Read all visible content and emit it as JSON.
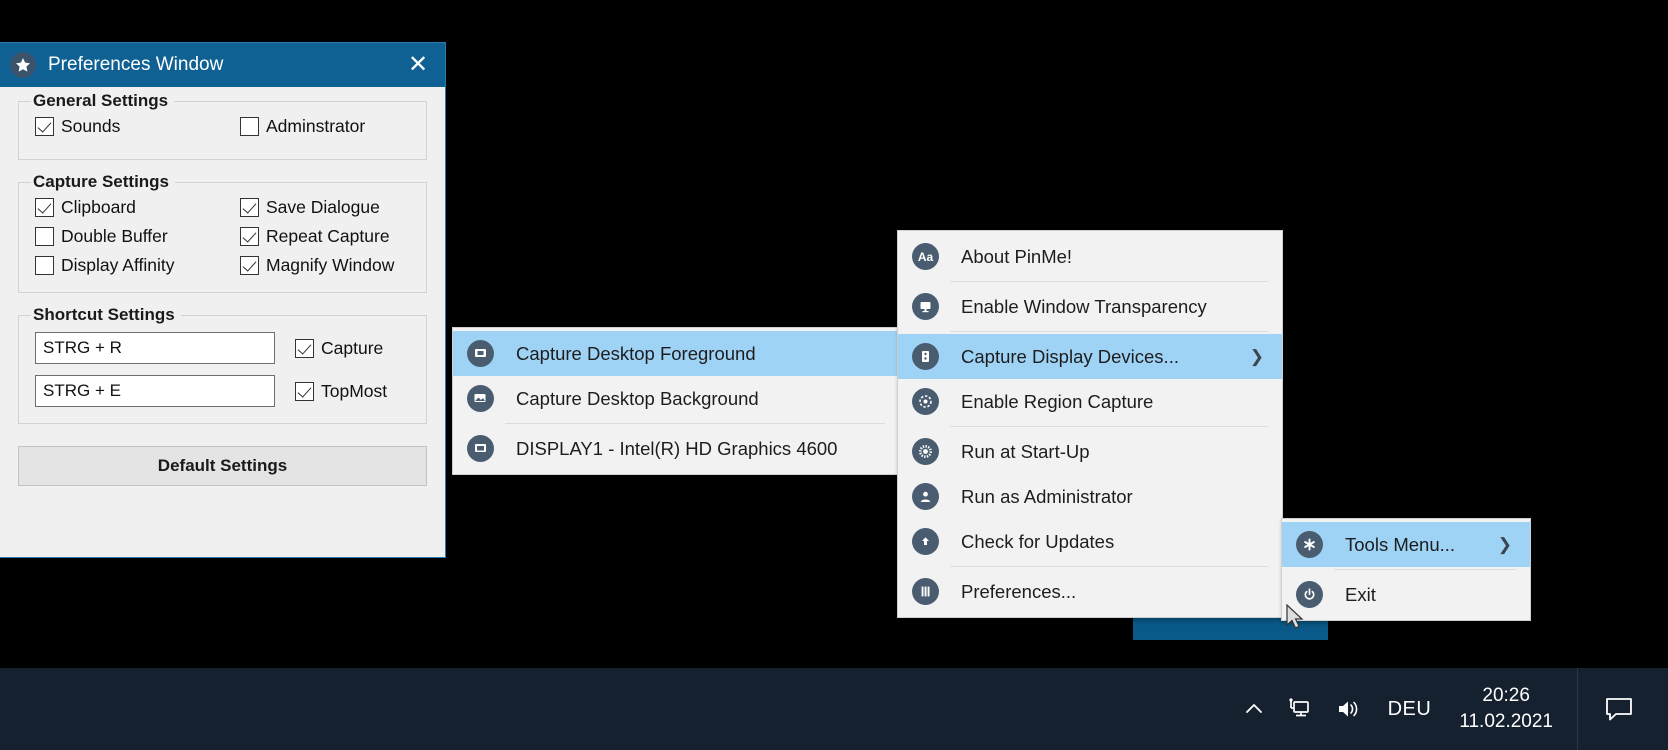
{
  "desktop": {
    "background_color": "#000000",
    "window_accent": "#0a5a89"
  },
  "preferences_window": {
    "title": "Preferences Window",
    "icon": "star-icon",
    "close_label": "✕",
    "groups": [
      {
        "title": "General Settings",
        "rows": [
          [
            {
              "label": "Sounds",
              "checked": true
            },
            {
              "label": "Adminstrator",
              "checked": false
            }
          ]
        ]
      },
      {
        "title": "Capture Settings",
        "rows": [
          [
            {
              "label": "Clipboard",
              "checked": true
            },
            {
              "label": "Save Dialogue",
              "checked": true
            }
          ],
          [
            {
              "label": "Double Buffer",
              "checked": false
            },
            {
              "label": "Repeat Capture",
              "checked": true
            }
          ],
          [
            {
              "label": "Display Affinity",
              "checked": false
            },
            {
              "label": "Magnify Window",
              "checked": true
            }
          ]
        ]
      }
    ],
    "shortcut_group": {
      "title": "Shortcut Settings",
      "rows": [
        {
          "value": "STRG + R",
          "checkbox_label": "Capture",
          "checked": true
        },
        {
          "value": "STRG + E",
          "checkbox_label": "TopMost",
          "checked": true
        }
      ]
    },
    "default_button": "Default Settings"
  },
  "menu_main": {
    "items": [
      {
        "label": "About PinMe!",
        "icon": "about-icon",
        "glyph": "Aa",
        "highlight": false,
        "submenu": false,
        "separator_after": true
      },
      {
        "label": "Enable Window Transparency",
        "icon": "monitor-icon",
        "glyph": "▢",
        "highlight": false,
        "submenu": false,
        "separator_after": true
      },
      {
        "label": "Capture Display Devices...",
        "icon": "display-devices-icon",
        "glyph": "☷",
        "highlight": true,
        "submenu": true,
        "separator_after": false
      },
      {
        "label": "Enable Region Capture",
        "icon": "region-capture-icon",
        "glyph": "◌",
        "highlight": false,
        "submenu": false,
        "separator_after": true
      },
      {
        "label": "Run at Start-Up",
        "icon": "gear-icon",
        "glyph": "⚙",
        "highlight": false,
        "submenu": false,
        "separator_after": false
      },
      {
        "label": "Run as Administrator",
        "icon": "user-icon",
        "glyph": "♟",
        "highlight": false,
        "submenu": false,
        "separator_after": false
      },
      {
        "label": "Check for Updates",
        "icon": "update-upload-icon",
        "glyph": "↑",
        "highlight": false,
        "submenu": false,
        "separator_after": true
      },
      {
        "label": "Preferences...",
        "icon": "sliders-icon",
        "glyph": "☰",
        "highlight": false,
        "submenu": false,
        "separator_after": false
      }
    ]
  },
  "menu_capture": {
    "items": [
      {
        "label": "Capture Desktop Foreground",
        "icon": "foreground-window-icon",
        "glyph": "■",
        "highlight": true,
        "separator_after": false
      },
      {
        "label": "Capture Desktop Background",
        "icon": "background-window-icon",
        "glyph": "◧",
        "highlight": false,
        "separator_after": true
      },
      {
        "label": "DISPLAY1 - Intel(R) HD Graphics 4600",
        "icon": "display-icon",
        "glyph": "▣",
        "highlight": false,
        "separator_after": false
      }
    ]
  },
  "menu_tray": {
    "items": [
      {
        "label": "Tools Menu...",
        "icon": "asterisk-tools-icon",
        "glyph": "✳",
        "highlight": true,
        "submenu": true,
        "separator_after": true
      },
      {
        "label": "Exit",
        "icon": "power-icon",
        "glyph": "⏻",
        "highlight": false,
        "submenu": false,
        "separator_after": false
      }
    ]
  },
  "taskbar": {
    "show_hidden_icons": "∧",
    "network_icon": "network-icon",
    "volume_icon": "volume-icon",
    "language": "DEU",
    "time": "20:26",
    "date": "11.02.2021",
    "action_center_icon": "action-center-icon"
  }
}
